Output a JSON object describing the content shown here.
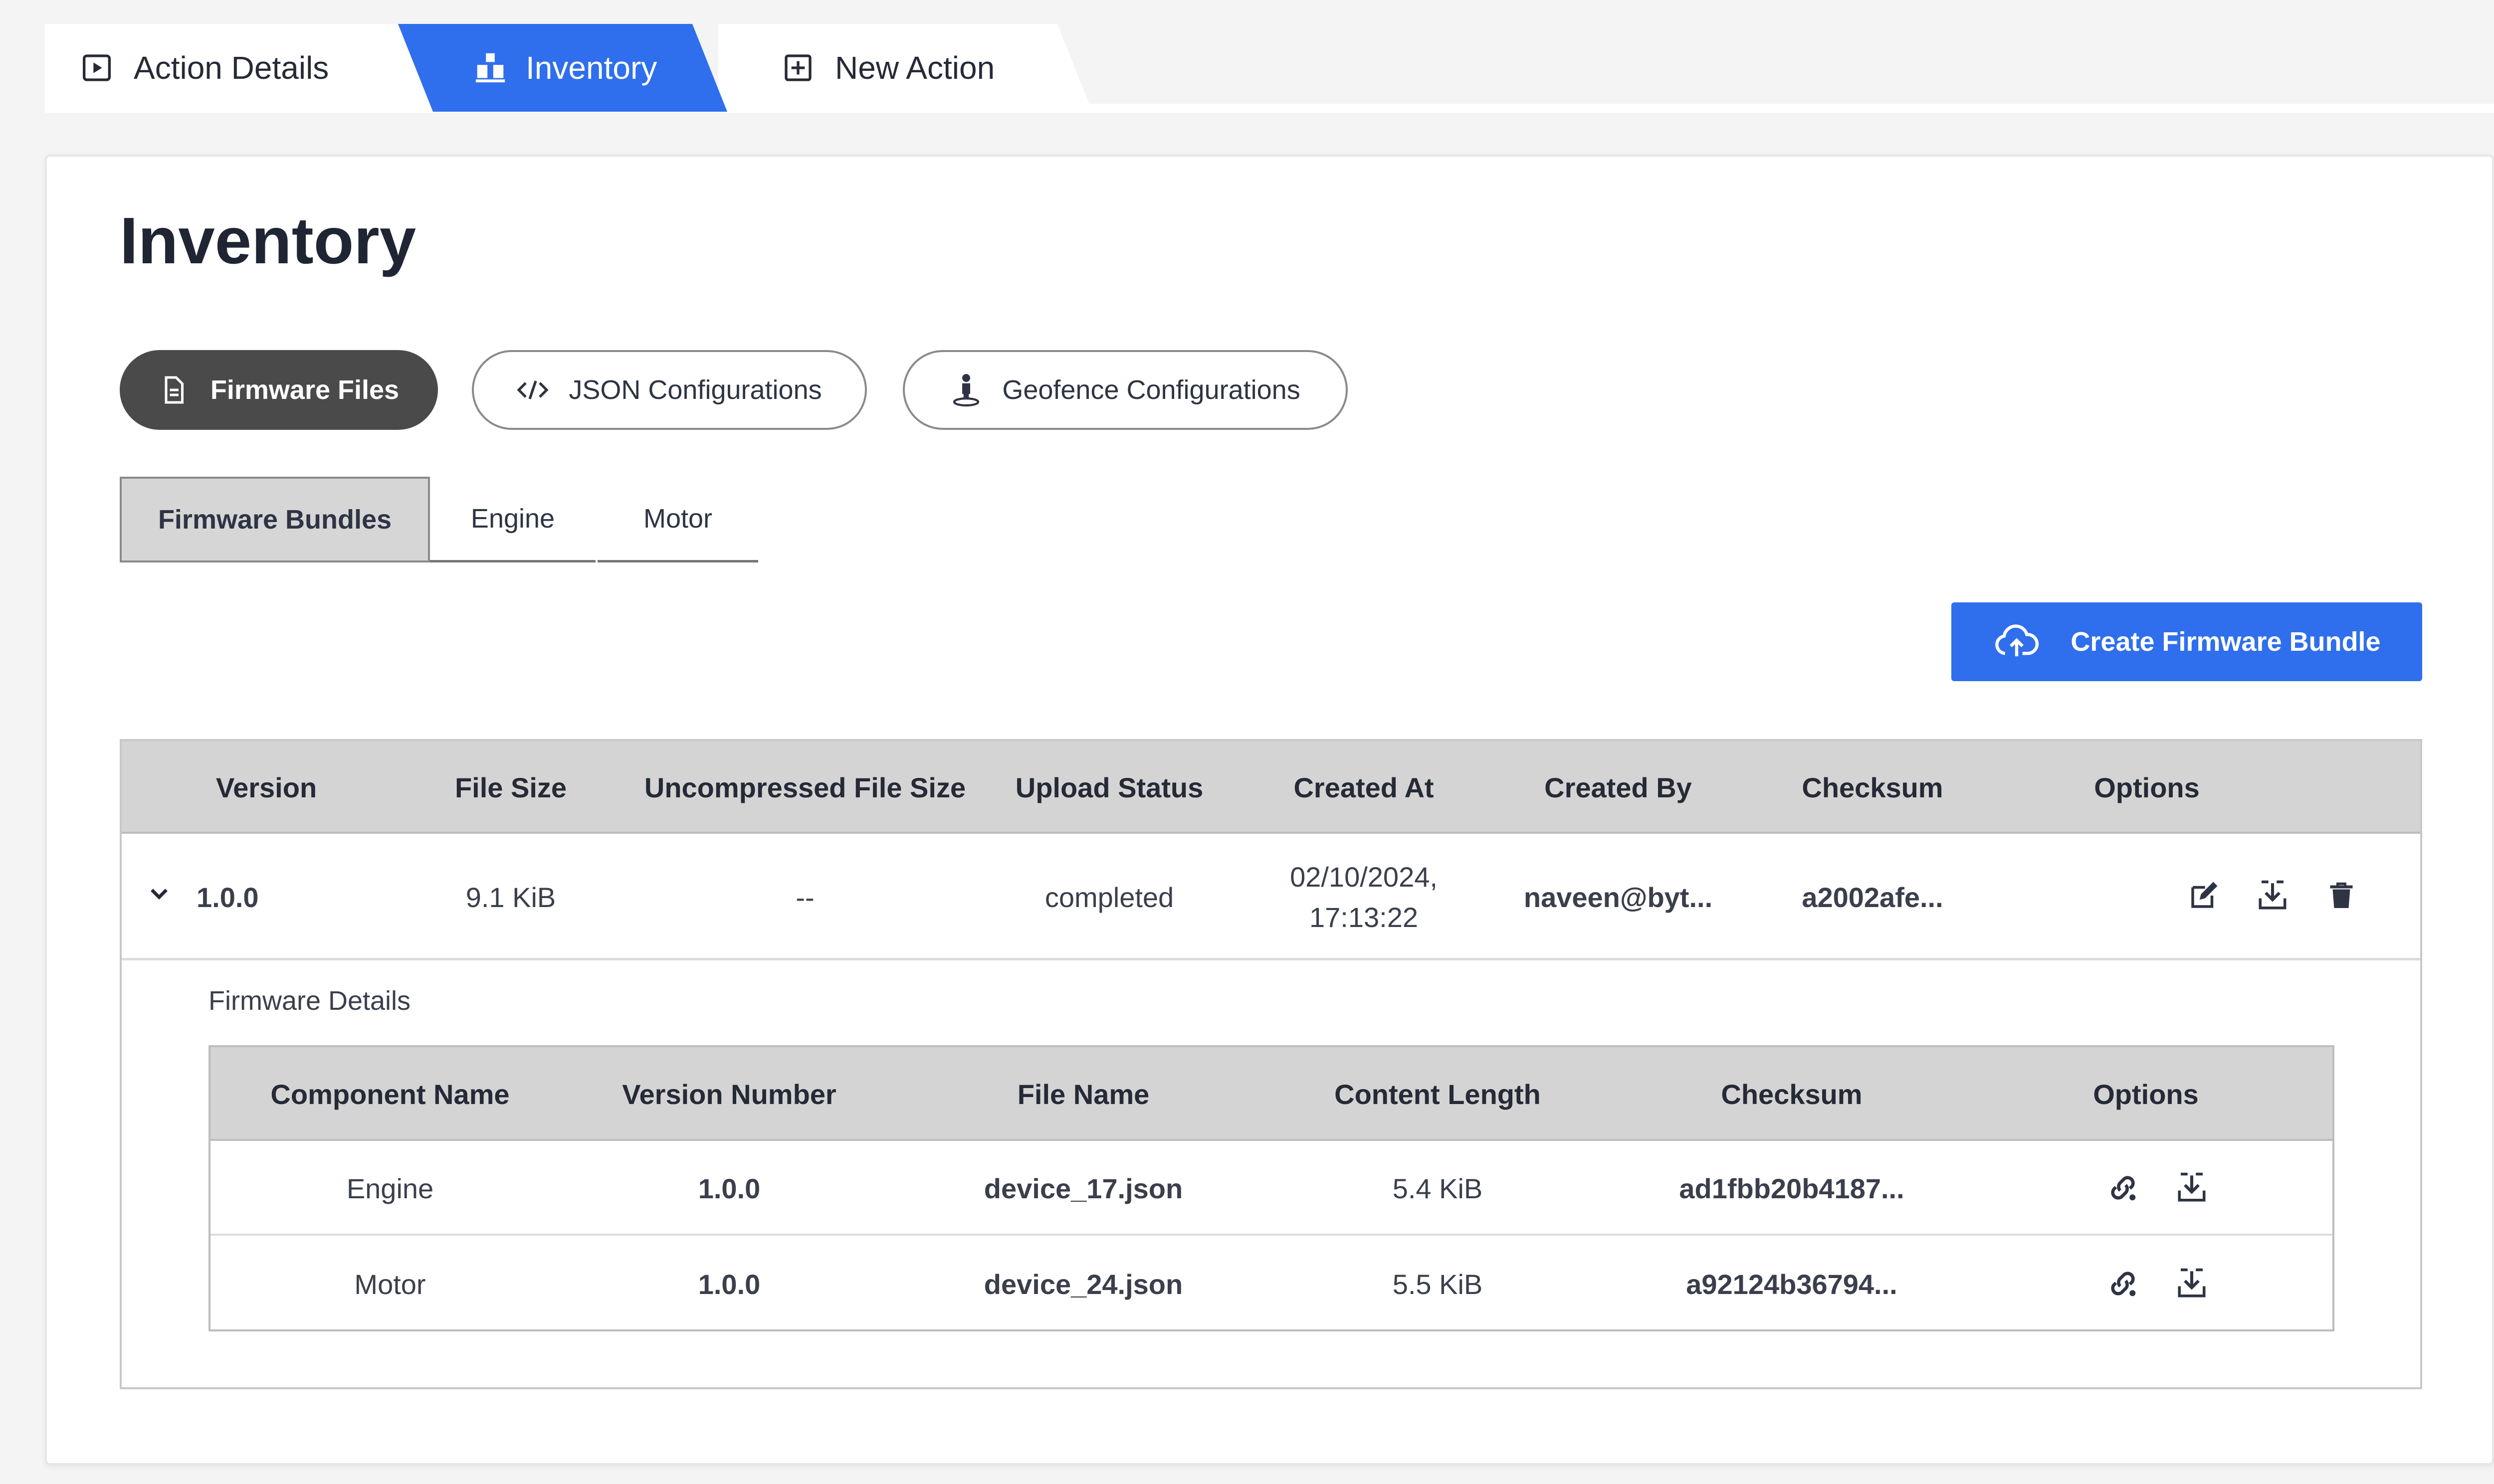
{
  "top_tabs": [
    {
      "label": "Action Details",
      "icon": "play-square-icon",
      "active": false
    },
    {
      "label": "Inventory",
      "icon": "boxes-icon",
      "active": true
    },
    {
      "label": "New Action",
      "icon": "plus-square-icon",
      "active": false
    }
  ],
  "colors": {
    "accent": "#2f6fed",
    "active_pill": "#4a4a4a",
    "header_bg": "#d4d4d4"
  },
  "page": {
    "title": "Inventory"
  },
  "pills": [
    {
      "label": "Firmware Files",
      "icon": "document-icon",
      "active": true
    },
    {
      "label": "JSON Configurations",
      "icon": "code-icon",
      "active": false
    },
    {
      "label": "Geofence Configurations",
      "icon": "person-pin-icon",
      "active": false
    }
  ],
  "subtabs": [
    {
      "label": "Firmware Bundles",
      "active": true
    },
    {
      "label": "Engine",
      "active": false
    },
    {
      "label": "Motor",
      "active": false
    }
  ],
  "create_button": {
    "label": "Create Firmware Bundle",
    "icon": "cloud-upload-icon"
  },
  "table": {
    "headers": [
      "Version",
      "File Size",
      "Uncompressed File Size",
      "Upload Status",
      "Created At",
      "Created By",
      "Checksum",
      "Options"
    ],
    "rows": [
      {
        "version": "1.0.0",
        "file_size": "9.1 KiB",
        "uncompressed_size": "--",
        "upload_status": "completed",
        "created_at_date": "02/10/2024,",
        "created_at_time": "17:13:22",
        "created_by": "naveen@byt...",
        "checksum": "a2002afe...",
        "options": [
          "edit-icon",
          "download-icon",
          "trash-icon"
        ],
        "expanded": true
      }
    ]
  },
  "details": {
    "label": "Firmware Details",
    "headers": [
      "Component Name",
      "Version Number",
      "File Name",
      "Content Length",
      "Checksum",
      "Options"
    ],
    "rows": [
      {
        "component": "Engine",
        "version": "1.0.0",
        "file_name": "device_17.json",
        "content_length": "5.4 KiB",
        "checksum": "ad1fbb20b4187...",
        "options": [
          "link-icon",
          "download-icon"
        ]
      },
      {
        "component": "Motor",
        "version": "1.0.0",
        "file_name": "device_24.json",
        "content_length": "5.5 KiB",
        "checksum": "a92124b36794...",
        "options": [
          "link-icon",
          "download-icon"
        ]
      }
    ]
  }
}
